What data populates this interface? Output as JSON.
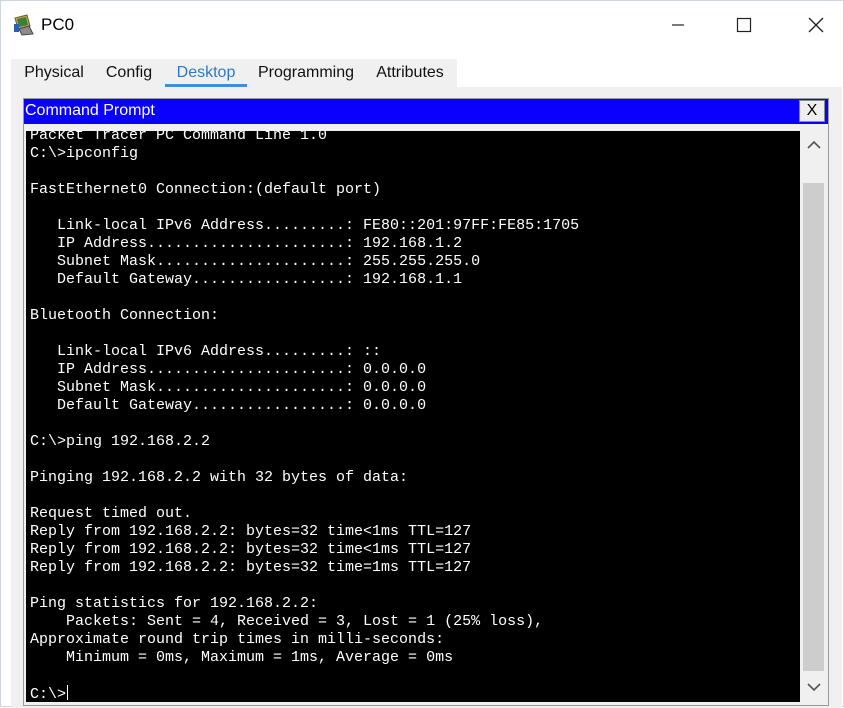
{
  "window": {
    "title": "PC0",
    "icon": "packet-tracer-pc-icon",
    "buttons": {
      "minimize": "minimize-icon",
      "maximize": "maximize-icon",
      "close": "close-icon"
    }
  },
  "tabs": [
    {
      "label": "Physical",
      "active": false
    },
    {
      "label": "Config",
      "active": false
    },
    {
      "label": "Desktop",
      "active": true
    },
    {
      "label": "Programming",
      "active": false
    },
    {
      "label": "Attributes",
      "active": false
    }
  ],
  "command_prompt": {
    "title": "Command Prompt",
    "close_label": "X",
    "header_color": "#0a00ff",
    "lines": [
      "Packet Tracer PC Command Line 1.0",
      "C:\\>ipconfig",
      "",
      "FastEthernet0 Connection:(default port)",
      "",
      "   Link-local IPv6 Address.........: FE80::201:97FF:FE85:1705",
      "   IP Address......................: 192.168.1.2",
      "   Subnet Mask.....................: 255.255.255.0",
      "   Default Gateway.................: 192.168.1.1",
      "",
      "Bluetooth Connection:",
      "",
      "   Link-local IPv6 Address.........: ::",
      "   IP Address......................: 0.0.0.0",
      "   Subnet Mask.....................: 0.0.0.0",
      "   Default Gateway.................: 0.0.0.0",
      "",
      "C:\\>ping 192.168.2.2",
      "",
      "Pinging 192.168.2.2 with 32 bytes of data:",
      "",
      "Request timed out.",
      "Reply from 192.168.2.2: bytes=32 time<1ms TTL=127",
      "Reply from 192.168.2.2: bytes=32 time<1ms TTL=127",
      "Reply from 192.168.2.2: bytes=32 time=1ms TTL=127",
      "",
      "Ping statistics for 192.168.2.2:",
      "    Packets: Sent = 4, Received = 3, Lost = 1 (25% loss),",
      "Approximate round trip times in milli-seconds:",
      "    Minimum = 0ms, Maximum = 1ms, Average = 0ms",
      ""
    ],
    "prompt": "C:\\>"
  },
  "scrollbar": {
    "up": "chevron-up-icon",
    "down": "chevron-down-icon"
  }
}
